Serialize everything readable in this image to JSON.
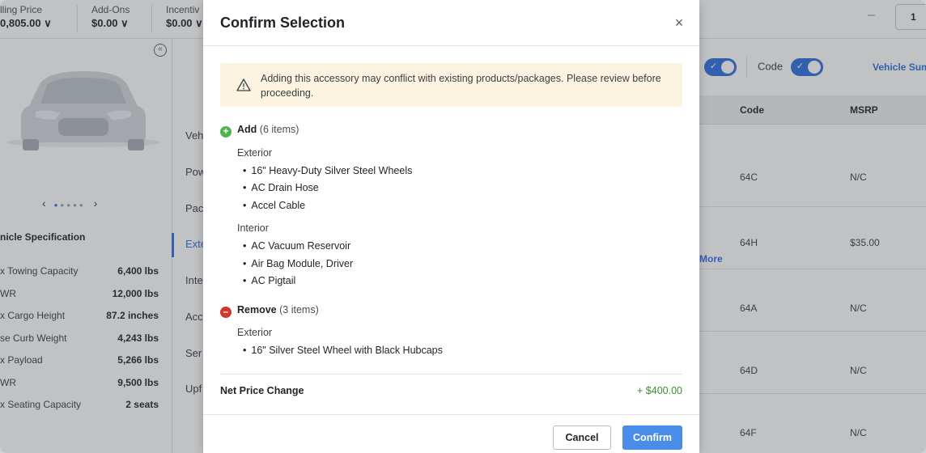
{
  "topbar": {
    "selling_price_label": "lling Price",
    "selling_price_value": "0,805.00 ∨",
    "addons_label": "Add-Ons",
    "addons_value": "$0.00 ∨",
    "incentives_label": "Incentiv",
    "incentives_value": "$0.00 ∨",
    "qty_minus": "–",
    "qty_value": "1"
  },
  "left_panel": {
    "carousel_prev": "‹",
    "carousel_next": "›",
    "spec_title": "nicle Specification",
    "specs": [
      {
        "label": "x Towing Capacity",
        "value": "6,400 lbs"
      },
      {
        "label": "WR",
        "value": "12,000 lbs"
      },
      {
        "label": "x Cargo Height",
        "value": "87.2 inches"
      },
      {
        "label": "se Curb Weight",
        "value": "4,243 lbs"
      },
      {
        "label": "x Payload",
        "value": "5,266 lbs"
      },
      {
        "label": "WR",
        "value": "9,500 lbs"
      },
      {
        "label": "x Seating Capacity",
        "value": "2 seats"
      }
    ]
  },
  "nav": [
    "Veh",
    "Pow",
    "Pac",
    "Exte",
    "Inte",
    "Acc",
    "Ser",
    "Upf"
  ],
  "right_area": {
    "code_toggle_label": "Code",
    "vehicle_summary_link": "Vehicle Sum",
    "col_code": "Code",
    "col_msrp": "MSRP",
    "more_link": "More",
    "rows": [
      {
        "code": "64C",
        "msrp": "N/C"
      },
      {
        "code": "64H",
        "msrp": "$35.00"
      },
      {
        "code": "64A",
        "msrp": "N/C"
      },
      {
        "code": "64D",
        "msrp": "N/C"
      },
      {
        "code": "64F",
        "msrp": "N/C"
      }
    ]
  },
  "modal": {
    "title": "Confirm Selection",
    "close": "×",
    "warning": "Adding this accessory may conflict with existing products/packages. Please review before proceeding.",
    "add_section": {
      "icon": "+",
      "label": "Add",
      "count": "(6 items)",
      "groups": [
        {
          "name": "Exterior",
          "items": [
            "16\" Heavy-Duty Silver Steel Wheels",
            "AC Drain Hose",
            "Accel Cable"
          ]
        },
        {
          "name": "Interior",
          "items": [
            "AC Vacuum Reservoir",
            "Air Bag Module, Driver",
            "AC Pigtail"
          ]
        }
      ]
    },
    "remove_section": {
      "icon": "–",
      "label": "Remove",
      "count": "(3 items)",
      "groups": [
        {
          "name": "Exterior",
          "items": [
            "16\" Silver Steel Wheel with Black Hubcaps"
          ]
        }
      ]
    },
    "net_price_label": "Net Price Change",
    "net_price_value": "+ $400.00",
    "cancel_label": "Cancel",
    "confirm_label": "Confirm"
  },
  "colors": {
    "accent": "#4a8de8",
    "add_green": "#4fb34e",
    "remove_red": "#d3372a",
    "warning_bg": "#fdf3e1",
    "price_green": "#3b8f2c"
  }
}
